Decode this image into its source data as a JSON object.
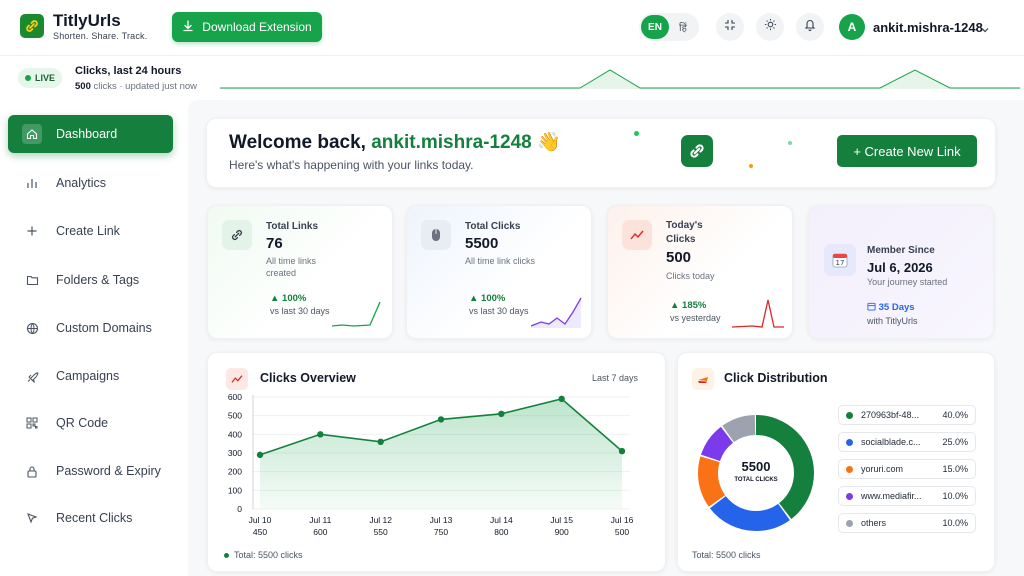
{
  "brand": {
    "name": "TitlyUrls",
    "tagline": "Shorten. Share. Track."
  },
  "header": {
    "download_label": "Download Extension",
    "lang_en": "EN",
    "lang_hi": "हिं",
    "user_initial": "A",
    "username": "ankit.mishra-1248"
  },
  "live": {
    "badge": "LIVE",
    "title": "Clicks, last 24 hours",
    "count": "500",
    "updated": " clicks · updated just now"
  },
  "sidebar": {
    "items": [
      {
        "label": "Dashboard",
        "icon": "home-icon"
      },
      {
        "label": "Analytics",
        "icon": "bar-chart-icon"
      },
      {
        "label": "Create Link",
        "icon": "plus-icon"
      },
      {
        "label": "Folders & Tags",
        "icon": "folder-icon"
      },
      {
        "label": "Custom Domains",
        "icon": "globe-icon"
      },
      {
        "label": "Campaigns",
        "icon": "rocket-icon"
      },
      {
        "label": "QR Code",
        "icon": "qr-icon"
      },
      {
        "label": "Password & Expiry",
        "icon": "lock-icon"
      },
      {
        "label": "Recent Clicks",
        "icon": "cursor-icon"
      }
    ]
  },
  "welcome": {
    "prefix": "Welcome back, ",
    "username": "ankit.mishra-1248",
    "emoji": "👋",
    "subtitle": "Here's what's happening with your links today.",
    "create_label": "+ Create New Link"
  },
  "stats": {
    "total_links": {
      "label": "Total Links",
      "value": "76",
      "desc": "All time links created",
      "change": "100%",
      "vs": "vs last 30 days"
    },
    "total_clicks": {
      "label": "Total Clicks",
      "value": "5500",
      "desc": "All time link clicks",
      "change": "100%",
      "vs": "vs last 30 days"
    },
    "today": {
      "label": "Today's Clicks",
      "value": "500",
      "desc": "Clicks today",
      "change": "185%",
      "vs": "vs yesterday"
    },
    "member": {
      "label": "Member Since",
      "value": "Jul 6, 2026",
      "desc": "Your journey started",
      "days": "35 Days",
      "with": "with TitlyUrls",
      "calendar_day": "17"
    }
  },
  "overview": {
    "title": "Clicks Overview",
    "range": "Last 7 days",
    "footnote": "Total: 5500 clicks"
  },
  "distribution": {
    "title": "Click Distribution",
    "center_value": "5500",
    "center_label": "TOTAL CLICKS",
    "footnote": "Total: 5500 clicks",
    "items": [
      {
        "name": "270963bf-48...",
        "pct": "40.0%",
        "value": 40,
        "color": "#15803d"
      },
      {
        "name": "socialblade.c...",
        "pct": "25.0%",
        "value": 25,
        "color": "#2563eb"
      },
      {
        "name": "yoruri.com",
        "pct": "15.0%",
        "value": 15,
        "color": "#f97316"
      },
      {
        "name": "www.mediafir...",
        "pct": "10.0%",
        "value": 10,
        "color": "#7c3aed"
      },
      {
        "name": "others",
        "pct": "10.0%",
        "value": 10,
        "color": "#9ca3af"
      }
    ]
  },
  "chart_data": {
    "type": "area",
    "categories": [
      "Jul 10",
      "Jul 11",
      "Jul 12",
      "Jul 13",
      "Jul 14",
      "Jul 15",
      "Jul 16"
    ],
    "values": [
      450,
      600,
      550,
      750,
      800,
      900,
      500
    ],
    "plotted": [
      290,
      400,
      360,
      480,
      510,
      590,
      310
    ],
    "yticks": [
      0,
      100,
      200,
      300,
      400,
      500,
      600
    ],
    "ylim": [
      0,
      600
    ],
    "title": "Clicks Overview",
    "xlabel": "",
    "ylabel": "",
    "grid": true,
    "color": "#15803d"
  }
}
